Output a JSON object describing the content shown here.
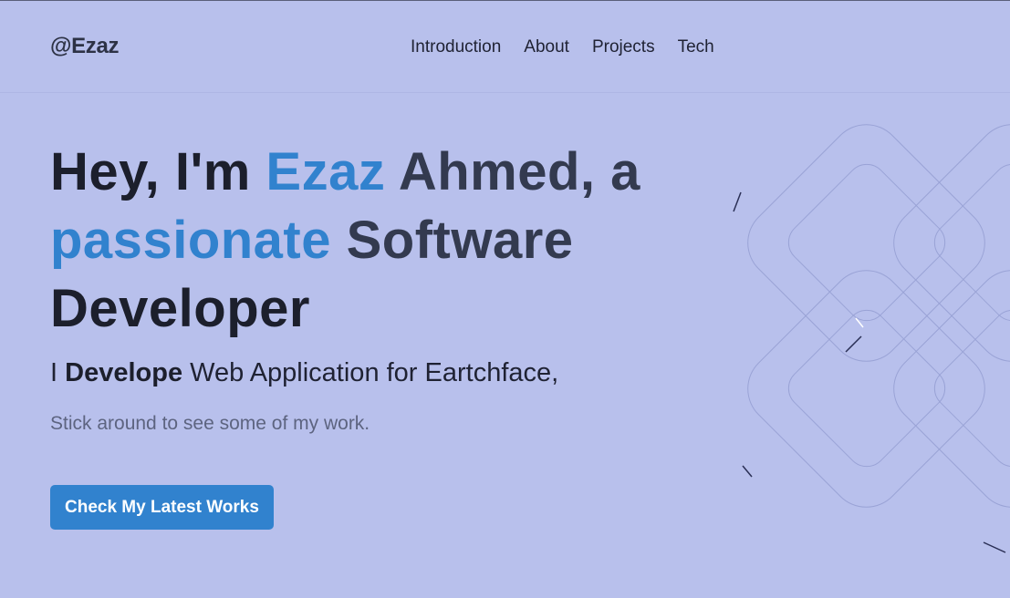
{
  "header": {
    "logo": "@Ezaz",
    "nav": [
      "Introduction",
      "About",
      "Projects",
      "Tech"
    ]
  },
  "hero": {
    "headline": {
      "part1": "Hey, I'm ",
      "name_first": "Ezaz",
      "name_rest": " Ahmed, a",
      "accent_word": "passionate",
      "part2": " Software",
      "part3": "Developer"
    },
    "tagline": {
      "prefix": "I ",
      "bold": "Develope",
      "suffix": " Web Application for Eartchface,"
    },
    "subline": "Stick around to see some of my work.",
    "cta_label": "Check My Latest Works"
  },
  "colors": {
    "background": "#b8c0ec",
    "accent": "#3182ce",
    "text_dark": "#1c1f2c"
  },
  "icons": {
    "decoration": "interlocking-rounded-shapes"
  }
}
